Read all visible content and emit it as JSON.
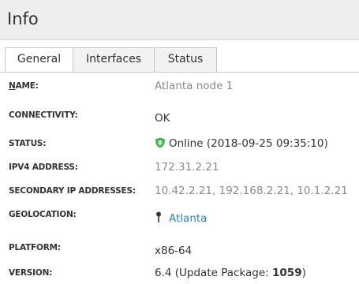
{
  "panel": {
    "title": "Info"
  },
  "tabs": [
    {
      "label": "General",
      "active": true
    },
    {
      "label": "Interfaces",
      "active": false
    },
    {
      "label": "Status",
      "active": false
    }
  ],
  "fields": {
    "name": {
      "label_underlined": "N",
      "label_rest": "AME:",
      "value": "Atlanta node 1"
    },
    "connectivity": {
      "label": "CONNECTIVITY:",
      "value": "OK"
    },
    "status": {
      "label": "STATUS:",
      "value": "Online (2018-09-25 09:35:10)",
      "icon": "shield-online-icon",
      "icon_color": "#3bb54a"
    },
    "ipv4": {
      "label": "IPV4 ADDRESS:",
      "value": "172.31.2.21"
    },
    "secondary_ip": {
      "label": "SECONDARY IP ADDRESSES:",
      "value": "10.42.2.21, 192.168.2.21, 10.1.2.21"
    },
    "geolocation": {
      "label": "GEOLOCATION:",
      "value": "Atlanta",
      "icon": "map-pin-icon"
    },
    "platform": {
      "label": "PLATFORM:",
      "value": "x86-64"
    },
    "version": {
      "label": "VERSION:",
      "value_prefix": "6.4 (Update Package: ",
      "value_bold": "1059",
      "value_suffix": ")"
    }
  },
  "colors": {
    "link": "#2a7fbd",
    "muted": "#8a8a8a",
    "header_bg": "#eeeeee"
  }
}
